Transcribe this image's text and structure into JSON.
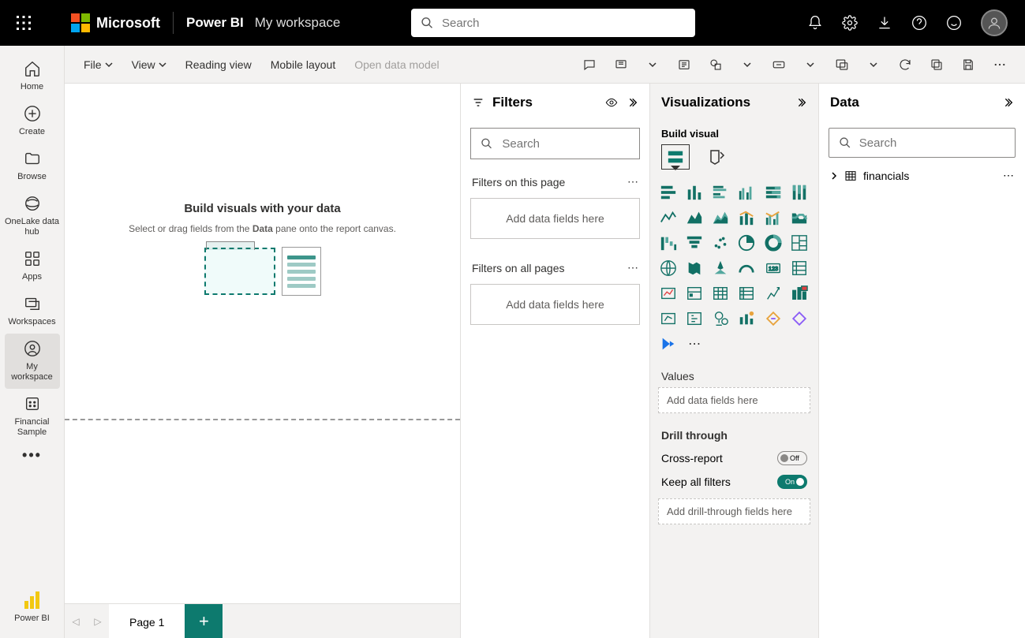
{
  "topbar": {
    "microsoft_label": "Microsoft",
    "product_label": "Power BI",
    "workspace_label": "My workspace",
    "search_placeholder": "Search"
  },
  "leftnav": {
    "home": "Home",
    "create": "Create",
    "browse": "Browse",
    "onelake": "OneLake data hub",
    "apps": "Apps",
    "workspaces": "Workspaces",
    "my_workspace": "My workspace",
    "financial_sample": "Financial Sample",
    "powerbi": "Power BI"
  },
  "ribbon": {
    "file": "File",
    "view": "View",
    "reading_view": "Reading view",
    "mobile_layout": "Mobile layout",
    "open_data_model": "Open data model"
  },
  "canvas": {
    "title": "Build visuals with your data",
    "subtitle_prefix": "Select or drag fields from the ",
    "subtitle_bold": "Data",
    "subtitle_suffix": " pane onto the report canvas."
  },
  "page_tabs": {
    "page1": "Page 1"
  },
  "filters": {
    "title": "Filters",
    "search_placeholder": "Search",
    "on_page": "Filters on this page",
    "all_pages": "Filters on all pages",
    "add_fields": "Add data fields here"
  },
  "viz": {
    "title": "Visualizations",
    "build_visual": "Build visual",
    "values": "Values",
    "add_fields": "Add data fields here",
    "drill_through": "Drill through",
    "cross_report": "Cross-report",
    "cross_report_state": "Off",
    "keep_filters": "Keep all filters",
    "keep_filters_state": "On",
    "add_drill": "Add drill-through fields here"
  },
  "data": {
    "title": "Data",
    "search_placeholder": "Search",
    "tables": [
      "financials"
    ]
  }
}
